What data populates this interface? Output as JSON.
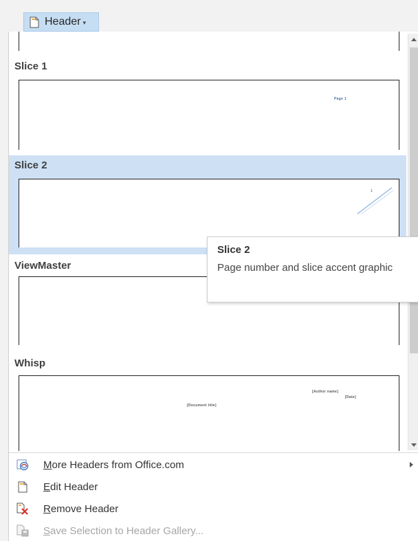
{
  "header_button": {
    "label": "Header",
    "caret": "▾",
    "icon": "document-icon"
  },
  "gallery": {
    "items": [
      {
        "title": "Slice 1",
        "preview_text": "Page 1",
        "accent_color": "#4a6fa5"
      },
      {
        "title": "Slice 2",
        "preview_text": "1",
        "accent_color": "#5b8fc7",
        "selected": true
      },
      {
        "title": "ViewMaster",
        "preview_text": ""
      },
      {
        "title": "Whisp",
        "preview_author": "[Author name]",
        "preview_date": "[Date]",
        "preview_doc_title": "[Document title]"
      }
    ]
  },
  "tooltip": {
    "title": "Slice 2",
    "description": "Page number and slice accent graphic"
  },
  "menu": {
    "items": [
      {
        "label": "More Headers from Office.com",
        "accel": "M",
        "rest": "ore Headers from Office.com",
        "icon": "office-globe-icon",
        "has_submenu": true,
        "enabled": true
      },
      {
        "label": "Edit Header",
        "accel": "E",
        "rest": "dit Header",
        "icon": "edit-header-icon",
        "enabled": true
      },
      {
        "label": "Remove Header",
        "accel": "R",
        "rest": "emove Header",
        "icon": "remove-header-icon",
        "enabled": true
      },
      {
        "label": "Save Selection to Header Gallery...",
        "accel": "S",
        "rest": "ave Selection to Header Gallery...",
        "icon": "save-selection-icon",
        "enabled": false
      }
    ]
  },
  "colors": {
    "selected_bg": "#cde0f4",
    "button_bg": "#c6def3",
    "accent_blue": "#2b579a"
  }
}
